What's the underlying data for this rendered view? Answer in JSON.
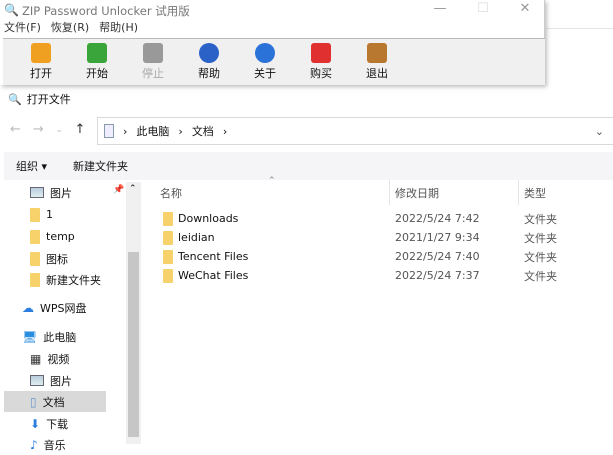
{
  "app": {
    "title": "ZIP Password Unlocker 试用版",
    "menu": [
      "文件(F)",
      "恢复(R)",
      "帮助(H)"
    ],
    "toolbar": [
      {
        "label": "打开",
        "color": "#f0a020"
      },
      {
        "label": "开始",
        "color": "#3aa53a"
      },
      {
        "label": "停止",
        "color": "#999999",
        "disabled": true
      },
      {
        "label": "帮助",
        "color": "#2a62c8"
      },
      {
        "label": "关于",
        "color": "#2a72d8"
      },
      {
        "label": "购买",
        "color": "#e03030"
      },
      {
        "label": "退出",
        "color": "#b87830"
      }
    ]
  },
  "dialog": {
    "title": "打开文件",
    "breadcrumb": [
      "此电脑",
      "文档"
    ],
    "organize": "组织 ▾",
    "new_folder": "新建文件夹"
  },
  "sidebar": [
    {
      "label": "图片",
      "icon": "image"
    },
    {
      "label": "1",
      "icon": "folder"
    },
    {
      "label": "temp",
      "icon": "folder"
    },
    {
      "label": "图标",
      "icon": "folder"
    },
    {
      "label": "新建文件夹",
      "icon": "folder"
    },
    {
      "label": "WPS网盘",
      "icon": "cloud"
    },
    {
      "label": "此电脑",
      "icon": "pc"
    },
    {
      "label": "视频",
      "icon": "video"
    },
    {
      "label": "图片",
      "icon": "image"
    },
    {
      "label": "文档",
      "icon": "doc",
      "selected": true
    },
    {
      "label": "下载",
      "icon": "download"
    },
    {
      "label": "音乐",
      "icon": "music"
    }
  ],
  "columns": {
    "name": "名称",
    "date": "修改日期",
    "type": "类型"
  },
  "files": [
    {
      "name": "Downloads",
      "date": "2022/5/24 7:42",
      "type": "文件夹"
    },
    {
      "name": "leidian",
      "date": "2021/1/27 9:34",
      "type": "文件夹"
    },
    {
      "name": "Tencent Files",
      "date": "2022/5/24 7:40",
      "type": "文件夹"
    },
    {
      "name": "WeChat Files",
      "date": "2022/5/24 7:37",
      "type": "文件夹"
    }
  ]
}
